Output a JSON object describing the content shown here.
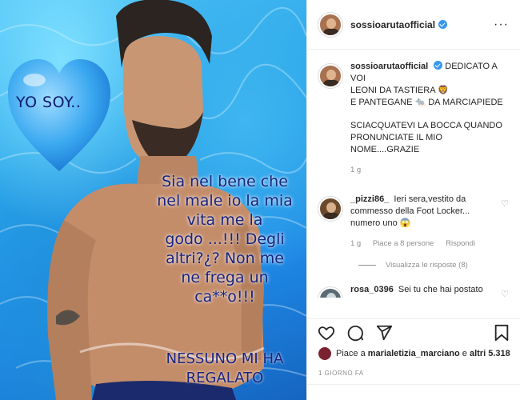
{
  "post_image": {
    "heart_text": "YO SOY..",
    "overlay_lines": [
      "Sia nel bene che",
      "nel male io la mia",
      "vita me la",
      "godo ...!!! Degli",
      "altri?¿? Non me",
      "ne frega un",
      "ca**o!!!"
    ],
    "overlay_caps": [
      "NESSUNO MI HA",
      "REGALATO"
    ]
  },
  "header": {
    "username": "sossioarutaofficial",
    "more_icon": "more-horizontal-icon"
  },
  "caption": {
    "username": "sossioarutaofficial",
    "lines": [
      "DEDICATO A VOI",
      "LEONI DA TASTIERA 🦁",
      "E PANTEGANE 🐀 DA MARCIAPIEDE"
    ],
    "line2": "SCIACQUATEVI LA BOCCA QUANDO PRONUNCIATE IL MIO NOME....GRAZIE",
    "time": "1 g"
  },
  "comments": [
    {
      "username": "_pizzi86_",
      "text": "Ieri sera,vestito da commesso della Foot Locker... numero uno 😱",
      "time": "1 g",
      "likes": "Piace a 8 persone",
      "reply": "Rispondi",
      "view_replies": "Visualizza le risposte (8)"
    },
    {
      "username": "rosa_0396",
      "text": "Sei tu che hai postato che ti avevano licenziato ...evita di scrivere se non vuoi essere"
    }
  ],
  "actions": {
    "like_icon": "heart-icon",
    "comment_icon": "comment-icon",
    "share_icon": "send-icon",
    "save_icon": "bookmark-icon"
  },
  "likes": {
    "prefix": "Piace a ",
    "user": "marialetizia_marciano",
    "middle": " e ",
    "others": "altri 5.318"
  },
  "date": "1 GIORNO FA",
  "colors": {
    "verified": "#3897f0",
    "secondary_text": "#8e8e8e",
    "border": "#efefef"
  }
}
